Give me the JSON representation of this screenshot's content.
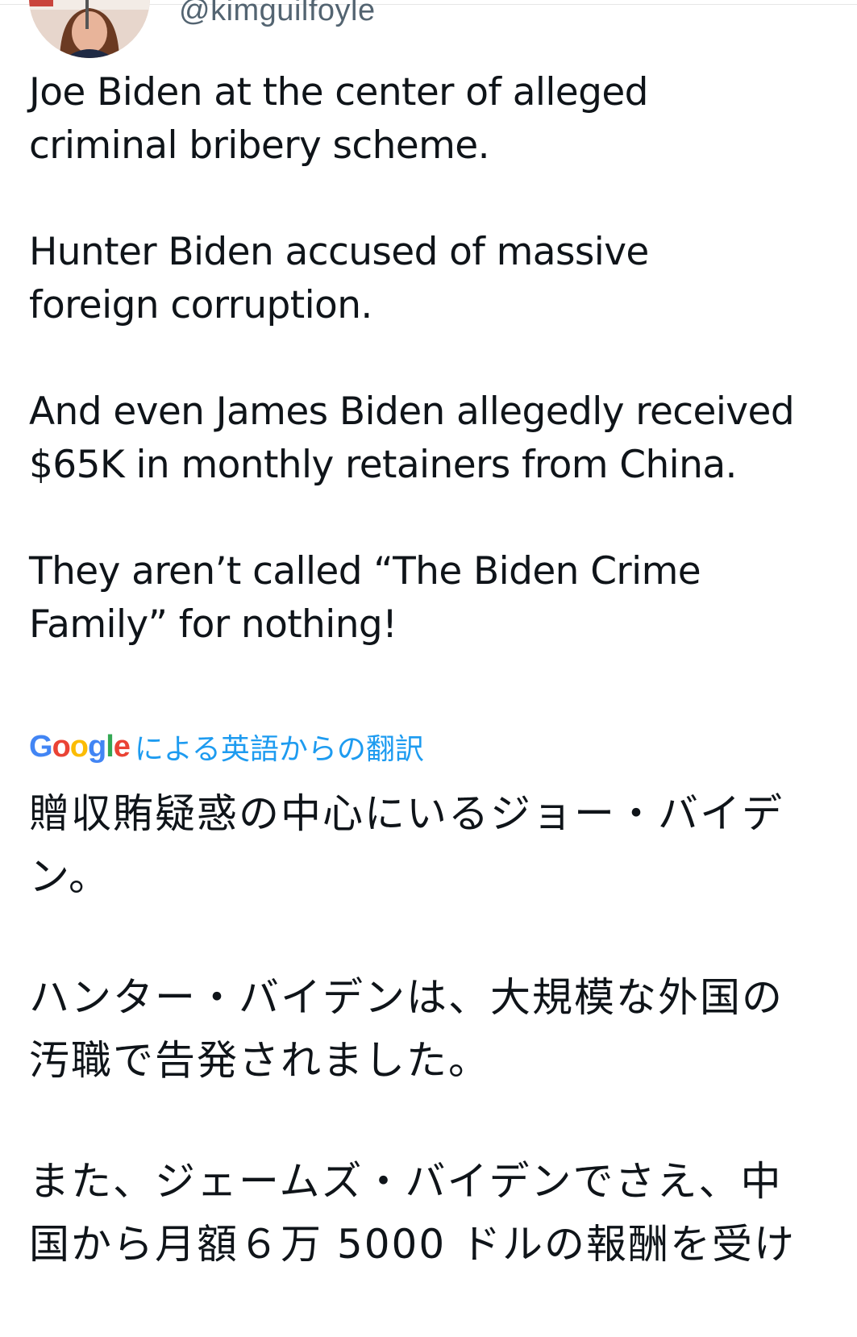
{
  "tweet": {
    "handle": "@kimguilfoyle",
    "paragraphs": [
      "Joe Biden at the center of alleged criminal bribery scheme.",
      "Hunter Biden accused of massive foreign corruption.",
      "And even James Biden allegedly received $65K in monthly retainers from China.",
      "They aren’t called “The Biden Crime Family” for nothing!"
    ]
  },
  "translation": {
    "logo_letters": [
      "G",
      "o",
      "o",
      "g",
      "l",
      "e"
    ],
    "label": "による英語からの翻訳",
    "paragraphs": [
      "贈収賄疑惑の中心にいるジョー・バイデン。",
      "ハンター・バイデンは、大規模な外国の汚職で告発されました。",
      "また、ジェームズ・バイデンでさえ、中国から月額６万 5000 ドルの報酬を受け"
    ]
  },
  "colors": {
    "text": "#0f1419",
    "handle": "#536471",
    "link": "#1d9bf0",
    "google_blue": "#4285f4",
    "google_red": "#ea4335",
    "google_yellow": "#fbbc05",
    "google_green": "#34a853"
  }
}
